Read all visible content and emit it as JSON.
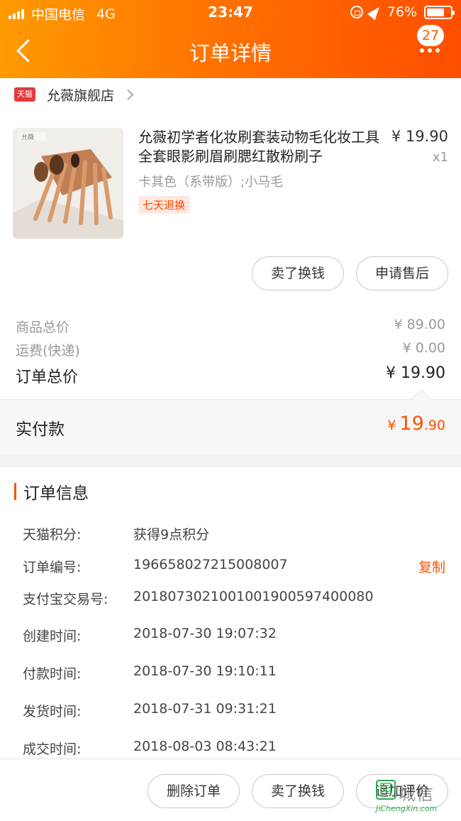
{
  "status_bar": {
    "carrier": "中国电信",
    "network": "4G",
    "time": "23:47",
    "battery": "76%",
    "battery_level": 0.76
  },
  "header": {
    "title": "订单详情",
    "badge_count": "27",
    "background_colors": [
      "#ff9a00",
      "#ff4e00"
    ]
  },
  "shop": {
    "platform_logo": "天猫",
    "name": "允薇旗舰店"
  },
  "product": {
    "title": "允薇初学者化妆刷套装动物毛化妆工具全套眼影刷眉刷腮红散粉刷子",
    "price": "¥ 19.90",
    "quantity": "x1",
    "sku": "卡其色（系带版）;小马毛",
    "tag": "七天退换",
    "thumb_brand": "允薇"
  },
  "product_actions": {
    "sell": "卖了换钱",
    "after_sale": "申请售后"
  },
  "summary": {
    "goods_label": "商品总价",
    "goods_value": "¥ 89.00",
    "shipping_label": "运费(快递)",
    "shipping_value": "¥ 0.00",
    "total_label": "订单总价",
    "total_value": "¥ 19.90"
  },
  "paid": {
    "label": "实付款",
    "currency": "¥",
    "integer": "19",
    "decimal": ".90"
  },
  "order_info": {
    "title": "订单信息",
    "copy": "复制",
    "rows": [
      {
        "label": "天猫积分:",
        "value": "获得9点积分"
      },
      {
        "label": "订单编号:",
        "value": "196658027215008007"
      },
      {
        "label": "支付宝交易号:",
        "value": "2018073021001001900597400080"
      },
      {
        "label": "创建时间:",
        "value": "2018-07-30 19:07:32"
      },
      {
        "label": "付款时间:",
        "value": "2018-07-30 19:10:11"
      },
      {
        "label": "发货时间:",
        "value": "2018-07-31 09:31:21"
      },
      {
        "label": "成交时间:",
        "value": "2018-08-03 08:43:21"
      }
    ]
  },
  "bottom_bar": {
    "delete": "删除订单",
    "sell": "卖了换钱",
    "review": "追加评价"
  },
  "watermark": {
    "text": "城信",
    "url": "JiChengXin.com",
    "icon": "园"
  },
  "accent_color": "#ff5000"
}
